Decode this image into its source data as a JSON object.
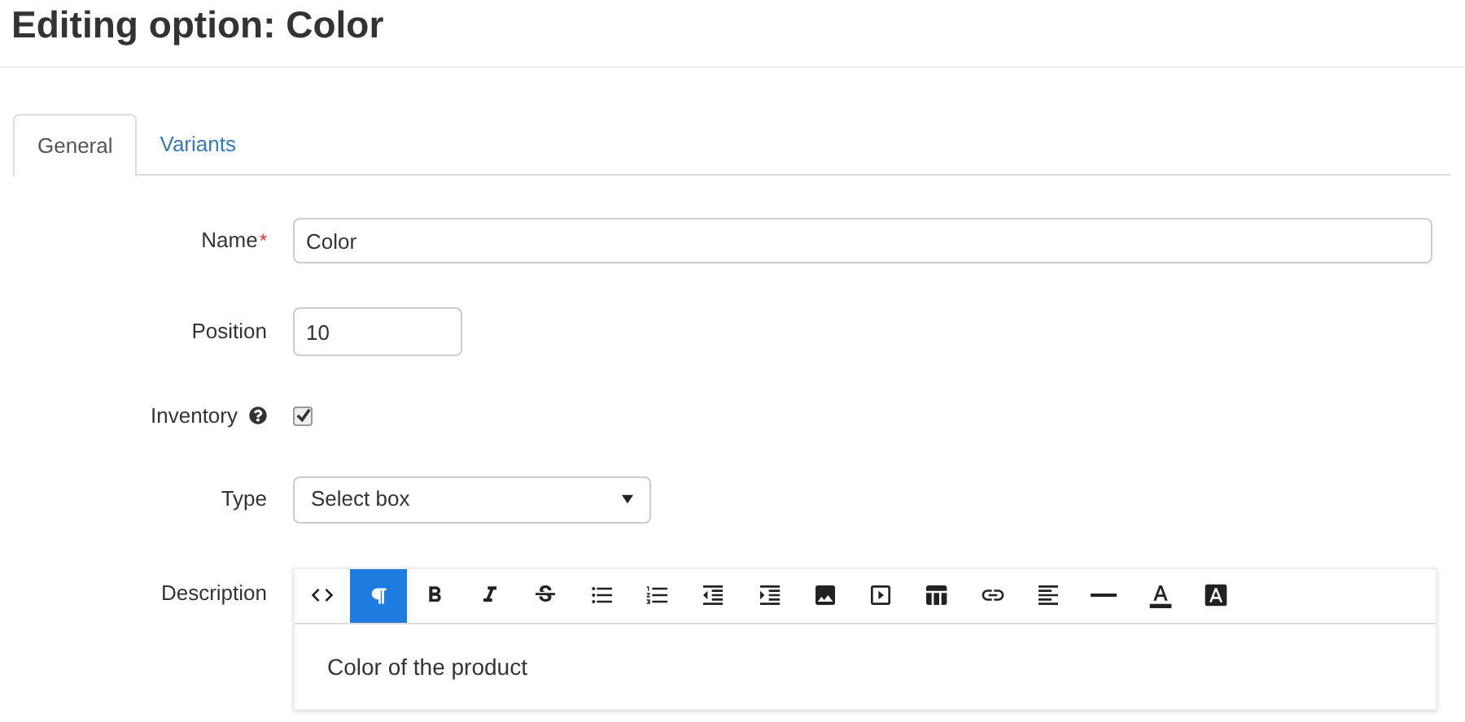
{
  "page_title": "Editing option: Color",
  "tabs": [
    {
      "label": "General",
      "selected": true
    },
    {
      "label": "Variants",
      "selected": false
    }
  ],
  "form": {
    "name": {
      "label": "Name",
      "required_mark": "*",
      "value": "Color"
    },
    "position": {
      "label": "Position",
      "value": "10"
    },
    "inventory": {
      "label": "Inventory",
      "checked": true
    },
    "type": {
      "label": "Type",
      "value": "Select box"
    },
    "description": {
      "label": "Description",
      "text": "Color of the product",
      "toolbar": [
        {
          "kind": "code",
          "selected": false
        },
        {
          "kind": "paragraph",
          "selected": true
        },
        {
          "kind": "bold",
          "selected": false
        },
        {
          "kind": "italic",
          "selected": false
        },
        {
          "kind": "strike",
          "selected": false
        },
        {
          "kind": "bullets",
          "selected": false
        },
        {
          "kind": "numbers",
          "selected": false
        },
        {
          "kind": "outdent",
          "selected": false
        },
        {
          "kind": "indent",
          "selected": false
        },
        {
          "kind": "image",
          "selected": false
        },
        {
          "kind": "video",
          "selected": false
        },
        {
          "kind": "table",
          "selected": false
        },
        {
          "kind": "link",
          "selected": false
        },
        {
          "kind": "align",
          "selected": false
        },
        {
          "kind": "rule",
          "selected": false
        },
        {
          "kind": "fontcolor",
          "selected": false
        },
        {
          "kind": "background",
          "selected": false
        }
      ]
    }
  }
}
